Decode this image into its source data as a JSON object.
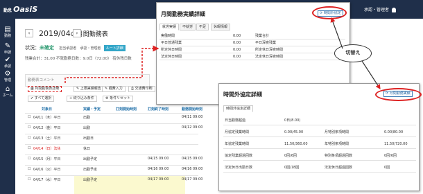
{
  "header": {
    "logo_small": "勤怠",
    "logo_big": "OasiS",
    "user": "承認・管理者"
  },
  "nav": [
    {
      "label": "勤務",
      "icon": "▤"
    },
    {
      "label": "申請",
      "icon": "✎"
    },
    {
      "label": "承認",
      "icon": "✔"
    },
    {
      "label": "管理",
      "icon": "⚙"
    },
    {
      "label": "ホーム",
      "icon": "⌂"
    }
  ],
  "main": {
    "title": "2019/04",
    "title_suffix": "の月間勤務表",
    "prev": "‹",
    "next": "›",
    "status_label": "状況：",
    "status": "未確定",
    "roles": [
      "担当承認者",
      "承認・管理者"
    ],
    "route_tag": "ルート詳細",
    "summary": "残業合計：31.00  不就勤務日数：9.0日（72.00）  有休残日数",
    "comment": "勤務表コメント",
    "buttons": {
      "monthly": "月間勤務表詳細",
      "extra": "上限実績報告",
      "expense": "経費入力",
      "transport": "交通費印刷",
      "select_all": "すべて選択",
      "filter": "絞り込み条件",
      "reset": "条件リセット"
    },
    "table": {
      "headers": [
        "対象日",
        "実績・予定",
        "打刻開始時刻",
        "打刻終了時刻",
        "勤務開始時刻"
      ],
      "rows": [
        {
          "date": "04/11（木）平日",
          "plan": "出勤",
          "s": "",
          "e": "",
          "w": "04/11 09:00",
          "red": false
        },
        {
          "date": "04/12（金）平日",
          "plan": "出勤",
          "s": "",
          "e": "",
          "w": "04/12 09:00",
          "red": false
        },
        {
          "date": "04/13（土）平日",
          "plan": "出勤日",
          "s": "",
          "e": "",
          "w": "",
          "red": false
        },
        {
          "date": "04/14（日）法休",
          "plan": "休日",
          "s": "",
          "e": "",
          "w": "",
          "red": true
        },
        {
          "date": "04/15（月）平日",
          "plan": "出勤予定",
          "s": "",
          "e": "04/15 09:00",
          "w": "04/15 09:00",
          "red": false
        },
        {
          "date": "04/16（火）平日",
          "plan": "出勤予定",
          "s": "",
          "e": "04/16 09:00",
          "w": "04/16 09:00",
          "red": false
        },
        {
          "date": "04/17（水）平日",
          "plan": "出勤予定",
          "s": "",
          "e": "04/17 09:00",
          "w": "04/17 09:00",
          "red": false
        }
      ]
    }
  },
  "panel1": {
    "title": "月間勤務実績詳細",
    "switch_button": "時間外協定",
    "tabs": [
      "就労実績",
      "不就労",
      "不足",
      "休暇情報"
    ],
    "rows": [
      {
        "l": "実働時間",
        "v": "0.00",
        "r": "残業合計"
      },
      {
        "l": "平日普通残業",
        "v": "0.00",
        "r": "平日深夜残業"
      },
      {
        "l": "所定休日時間",
        "v": "0.00",
        "r": "所定休日深夜時間"
      },
      {
        "l": "法定休日時間",
        "v": "0.00",
        "r": "法定休日深夜時間"
      }
    ]
  },
  "panel2": {
    "title": "時間外協定詳細",
    "switch_button": "月間勤務実績",
    "tab": "時間外協定詳細",
    "rows": [
      {
        "l": "日当勤務超過",
        "v": "0日(8.00)",
        "r": "",
        "rv": ""
      },
      {
        "l": "月協定残業時間",
        "v": "0.00/45.00",
        "r": "月特別条項時間",
        "rv": "0.00/80.00"
      },
      {
        "l": "年協定残業時間",
        "v": "11.50/360.00",
        "r": "年特別条項時間",
        "rv": "11.50/720.00"
      },
      {
        "l": "協定残業超過回数",
        "v": "0回/6回",
        "r": "特別条項超過回数",
        "rv": "0回/6回"
      },
      {
        "l": "法定休日出勤日数",
        "v": "0回/18回",
        "r": "法定休日超過回数",
        "rv": "0回"
      }
    ]
  },
  "callout": "切替え",
  "colors": {
    "nav_bg": "#1f2f4a",
    "accent": "#33a6c8",
    "annotation_red": "#d22222",
    "status_green": "#2e9b72"
  }
}
